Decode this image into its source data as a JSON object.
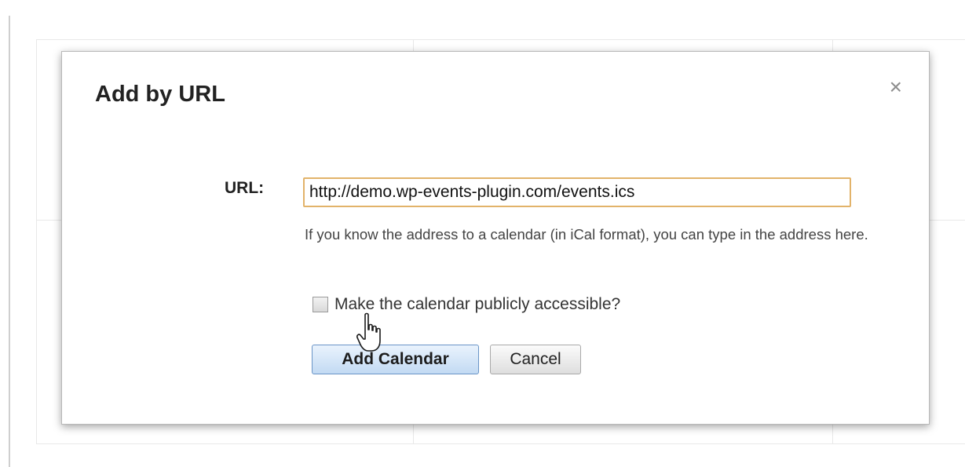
{
  "dialog": {
    "title": "Add by URL",
    "close_glyph": "×",
    "url_label": "URL:",
    "url_value": "http://demo.wp-events-plugin.com/events.ics",
    "help_text": "If you know the address to a calendar (in iCal format), you can type in the address here.",
    "public_checkbox_label": "Make the calendar publicly accessible?",
    "public_checked": false,
    "add_button_label": "Add Calendar",
    "cancel_button_label": "Cancel"
  },
  "icons": {
    "close": "close-icon",
    "cursor": "hand-pointer-icon"
  },
  "colors": {
    "input_focus_border": "#e2b36a",
    "primary_button_top": "#eaf3fd",
    "primary_button_bottom": "#c2daf3",
    "primary_button_border": "#6a95c7"
  }
}
